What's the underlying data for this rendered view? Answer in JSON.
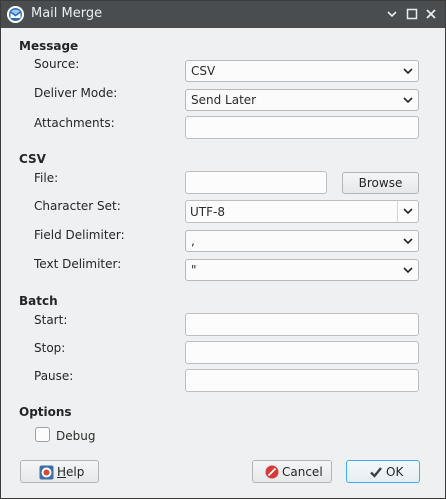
{
  "window": {
    "title": "Mail Merge",
    "icon": "thunderbird-icon",
    "controls": [
      "minimize-icon",
      "maximize-icon",
      "close-icon"
    ]
  },
  "message": {
    "section_title": "Message",
    "source_label": "Source:",
    "source_value": "CSV",
    "deliver_mode_label": "Deliver Mode:",
    "deliver_mode_value": "Send Later",
    "attachments_label": "Attachments:",
    "attachments_value": ""
  },
  "csv": {
    "section_title": "CSV",
    "file_label": "File:",
    "file_value": "",
    "browse_label": "Browse",
    "charset_label": "Character Set:",
    "charset_value": "UTF-8",
    "field_delim_label": "Field Delimiter:",
    "field_delim_value": ",",
    "text_delim_label": "Text Delimiter:",
    "text_delim_value": "\""
  },
  "batch": {
    "section_title": "Batch",
    "start_label": "Start:",
    "start_value": "",
    "stop_label": "Stop:",
    "stop_value": "",
    "pause_label": "Pause:",
    "pause_value": ""
  },
  "options": {
    "section_title": "Options",
    "debug_label": "Debug",
    "debug_checked": false
  },
  "buttons": {
    "help_prefix": "",
    "help_accel": "H",
    "help_rest": "elp",
    "cancel_label": "Cancel",
    "ok_label": "OK"
  },
  "colors": {
    "titlebar": "#4a4d50",
    "focus": "#3daee9",
    "cancel_icon": "#d63a3a"
  }
}
